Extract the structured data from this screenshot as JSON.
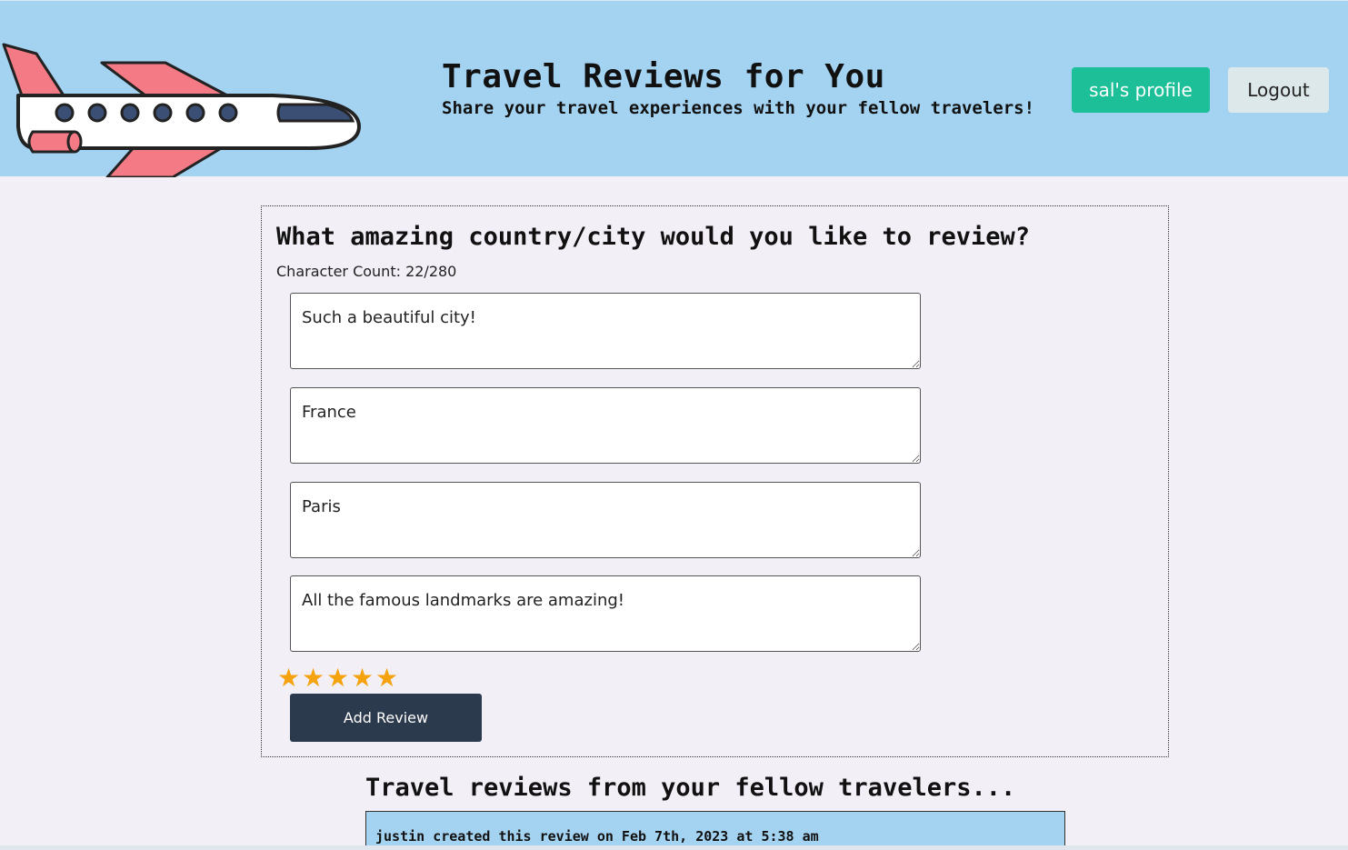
{
  "header": {
    "title": "Travel Reviews for You",
    "subtitle": "Share your travel experiences with your fellow travelers!",
    "profile_button": "sal's profile",
    "logout_button": "Logout",
    "logo_icon": "airplane-icon",
    "background_color": "#a3d3f1"
  },
  "review_form": {
    "heading": "What amazing country/city would you like to review?",
    "char_count": "Character Count: 22/280",
    "fields": [
      {
        "value": "Such a beautiful city!"
      },
      {
        "value": "France"
      },
      {
        "value": "Paris"
      },
      {
        "value": "All the famous landmarks are amazing!"
      }
    ],
    "rating": {
      "value": 5,
      "max": 5,
      "icon": "star-icon",
      "color": "#f5a20f"
    },
    "submit_button": "Add Review",
    "submit_color": "#2c3a4d"
  },
  "reviews": {
    "heading": "Travel reviews from your fellow travelers...",
    "items": [
      {
        "meta": "justin created this review on Feb 7th, 2023 at 5:38 am"
      }
    ]
  },
  "colors": {
    "page_background": "#f2eff6",
    "profile_button": "#1cbf98",
    "logout_button": "#dde8ea"
  }
}
